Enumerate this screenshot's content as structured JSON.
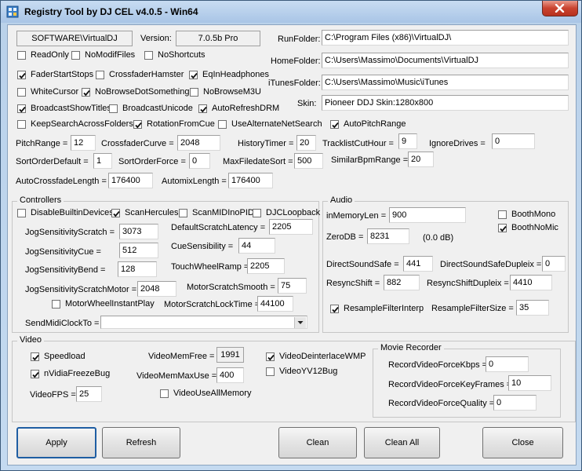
{
  "window": {
    "title": "Registry Tool by DJ CEL v4.0.5 - Win64"
  },
  "top": {
    "registry_key": "SOFTWARE\\VirtualDJ",
    "version_label": "Version:",
    "version_value": "7.0.5b Pro",
    "run_folder_label": "RunFolder:",
    "run_folder_value": "C:\\Program Files (x86)\\VirtualDJ\\",
    "home_folder_label": "HomeFolder:",
    "home_folder_value": "C:\\Users\\Massimo\\Documents\\VirtualDJ",
    "itunes_folder_label": "iTunesFolder:",
    "itunes_folder_value": "C:\\Users\\Massimo\\Music\\iTunes",
    "skin_label": "Skin:",
    "skin_value": "Pioneer DDJ Skin:1280x800"
  },
  "checkboxes": {
    "readonly": {
      "label": "ReadOnly",
      "checked": false
    },
    "nomodiffiles": {
      "label": "NoModifFiles",
      "checked": false
    },
    "noshortcuts": {
      "label": "NoShortcuts",
      "checked": false
    },
    "faderstartstops": {
      "label": "FaderStartStops",
      "checked": true
    },
    "crossfaderhamster": {
      "label": "CrossfaderHamster",
      "checked": false
    },
    "eqinheadphones": {
      "label": "EqInHeadphones",
      "checked": true
    },
    "whitecursor": {
      "label": "WhiteCursor",
      "checked": false
    },
    "nobrowsedotsomething": {
      "label": "NoBrowseDotSomething",
      "checked": true
    },
    "nobrowsem3u": {
      "label": "NoBrowseM3U",
      "checked": false
    },
    "broadcastshowtitles": {
      "label": "BroadcastShowTitles",
      "checked": true
    },
    "broadcastunicode": {
      "label": "BroadcastUnicode",
      "checked": false
    },
    "autorefreshdrm": {
      "label": "AutoRefreshDRM",
      "checked": true
    },
    "keepsearchacrossfolders": {
      "label": "KeepSearchAcrossFolders",
      "checked": false
    },
    "rotationfromcue": {
      "label": "RotationFromCue",
      "checked": true
    },
    "usealternatenetsearch": {
      "label": "UseAlternateNetSearch",
      "checked": false
    },
    "autopitchrange": {
      "label": "AutoPitchRange",
      "checked": true
    }
  },
  "fields": {
    "pitchrange": {
      "label": "PitchRange =",
      "value": "12"
    },
    "crossfadercurve": {
      "label": "CrossfaderCurve =",
      "value": "2048"
    },
    "historytimer": {
      "label": "HistoryTimer =",
      "value": "20"
    },
    "tracklistcuthour": {
      "label": "TracklistCutHour =",
      "value": "9"
    },
    "ignoredrives": {
      "label": "IgnoreDrives =",
      "value": "0"
    },
    "sortorderdefault": {
      "label": "SortOrderDefault =",
      "value": "1"
    },
    "sortorderforce": {
      "label": "SortOrderForce =",
      "value": "0"
    },
    "maxfiledatesort": {
      "label": "MaxFiledateSort =",
      "value": "500"
    },
    "similarbpmrange": {
      "label": "SimilarBpmRange =",
      "value": "20"
    },
    "autocrossfadelength": {
      "label": "AutoCrossfadeLength =",
      "value": "176400"
    },
    "automixlength": {
      "label": "AutomixLength =",
      "value": "176400"
    }
  },
  "controllers": {
    "title": "Controllers",
    "disablebuiltindevices": {
      "label": "DisableBuiltinDevices",
      "checked": false
    },
    "scanhercules": {
      "label": "ScanHercules",
      "checked": true
    },
    "scanmidinopid": {
      "label": "ScanMIDInoPID",
      "checked": false
    },
    "djcloopback": {
      "label": "DJCLoopback",
      "checked": false
    },
    "jogsensitivityscratch": {
      "label": "JogSensitivityScratch =",
      "value": "3073"
    },
    "defaultscratchlatency": {
      "label": "DefaultScratchLatency =",
      "value": "2205"
    },
    "jogsensitivitycue": {
      "label": "JogSensitivityCue =",
      "value": "512"
    },
    "cuesensibility": {
      "label": "CueSensibility =",
      "value": "44"
    },
    "jogsensitivitybend": {
      "label": "JogSensitivityBend =",
      "value": "128"
    },
    "touchwheelramp": {
      "label": "TouchWheelRamp =",
      "value": "2205"
    },
    "jogsensitivityscratchmotor": {
      "label": "JogSensitivityScratchMotor =",
      "value": "2048"
    },
    "motorscratchsmooth": {
      "label": "MotorScratchSmooth =",
      "value": "75"
    },
    "motorwheelinstantplay": {
      "label": "MotorWheelInstantPlay",
      "checked": false
    },
    "motorscratchlocktime": {
      "label": "MotorScratchLockTime =",
      "value": "44100"
    },
    "sendmidiclockto_label": "SendMidiClockTo =",
    "sendmidiclockto_value": ""
  },
  "audio": {
    "title": "Audio",
    "inmemorylen": {
      "label": "inMemoryLen =",
      "value": "900"
    },
    "boothmono": {
      "label": "BoothMono",
      "checked": false
    },
    "boothnomic": {
      "label": "BoothNoMic",
      "checked": true
    },
    "zerodb": {
      "label": "ZeroDB =",
      "value": "8231",
      "note": "(0.0 dB)"
    },
    "directsoundsafe": {
      "label": "DirectSoundSafe =",
      "value": "441"
    },
    "directsoundsafeduplex": {
      "label": "DirectSoundSafeDupleix =",
      "value": "0"
    },
    "resyncshift": {
      "label": "ResyncShift =",
      "value": "882"
    },
    "resyncshiftduplex": {
      "label": "ResyncShiftDupleix =",
      "value": "4410"
    },
    "resamplefilterinterp": {
      "label": "ResampleFilterInterp",
      "checked": true
    },
    "resamplefiltersize": {
      "label": "ResampleFilterSize =",
      "value": "35"
    }
  },
  "video": {
    "title": "Video",
    "speedload": {
      "label": "Speedload",
      "checked": true
    },
    "nvidiafreezebug": {
      "label": "nVidiaFreezeBug",
      "checked": true
    },
    "videofps": {
      "label": "VideoFPS =",
      "value": "25"
    },
    "videomemfree": {
      "label": "VideoMemFree =",
      "value": "1991"
    },
    "videomemmaxuse": {
      "label": "VideoMemMaxUse =",
      "value": "400"
    },
    "videouseallmemory": {
      "label": "VideoUseAllMemory",
      "checked": false
    },
    "videodeinterlacewmp": {
      "label": "VideoDeinterlaceWMP",
      "checked": true
    },
    "videoyv12bug": {
      "label": "VideoYV12Bug",
      "checked": false
    }
  },
  "movie_recorder": {
    "title": "Movie Recorder",
    "recordvideoforcekbps": {
      "label": "RecordVideoForceKbps =",
      "value": "0"
    },
    "recordvideoforcekeyframes": {
      "label": "RecordVideoForceKeyFrames =",
      "value": "10"
    },
    "recordvideoforcequality": {
      "label": "RecordVideoForceQuality =",
      "value": "0"
    }
  },
  "buttons": {
    "apply": "Apply",
    "refresh": "Refresh",
    "clean": "Clean",
    "clean_all": "Clean All",
    "close": "Close"
  },
  "colors": {
    "title_bar": "#b9d1ea",
    "client": "#f0f0f0",
    "close_button": "#c9432f",
    "focus_border": "#1f5ea3"
  }
}
